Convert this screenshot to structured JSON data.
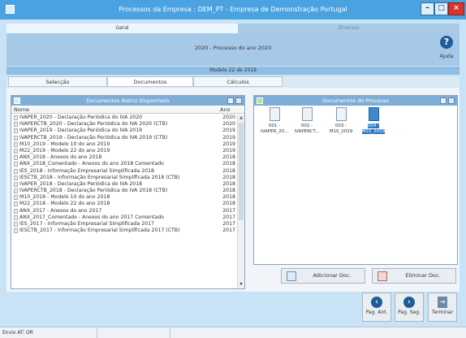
{
  "window": {
    "title": "Processos da Empresa : DEM_PT - Empresa de Demonstração Portugal"
  },
  "main_tabs": [
    "Geral",
    "Diversos"
  ],
  "process_title": "2020 - Processo do ano 2020",
  "help_label": "Ajuda",
  "modelo_title": "Modelo 22 de 2019",
  "sub_tabs": [
    "Selecção",
    "Documentos",
    "Cálculos"
  ],
  "left_panel": {
    "title": "Documentos Matriz Disponíveis",
    "col_nome": "Nome",
    "col_ano": "Ano",
    "rows": [
      {
        "name": "IVAPER_2020 - Declaração Periódica do IVA 2020",
        "year": "2020"
      },
      {
        "name": "IVAPERCTB_2020 - Declaração Periódica do IVA 2020  (CTB)",
        "year": "2020"
      },
      {
        "name": "IVAPER_2019 - Declaração Periódica do IVA 2019",
        "year": "2019"
      },
      {
        "name": "IVAPERCTB_2019 - Declaração Periódica do IVA 2019  (CTB)",
        "year": "2019"
      },
      {
        "name": "M10_2019 - Modelo 10 do ano 2019",
        "year": "2019"
      },
      {
        "name": "M22_2019 - Modelo 22 do ano 2019",
        "year": "2019"
      },
      {
        "name": "ANX_2018 - Anexos do ano 2018",
        "year": "2018"
      },
      {
        "name": "ANX_2018_Comentado - Anexos do ano 2018 Comentado",
        "year": "2018"
      },
      {
        "name": "IES_2018 - Informação Empresarial Simplificada 2018",
        "year": "2018"
      },
      {
        "name": "IESCTB_2018 - Informação Empresarial Simplificada 2018 (CTB)",
        "year": "2018"
      },
      {
        "name": "IVAPER_2018 - Declaração Periódica do IVA 2018",
        "year": "2018"
      },
      {
        "name": "IVAPERCTB_2018 - Declaração Periódica do IVA 2018  (CTB)",
        "year": "2018"
      },
      {
        "name": "M10_2018 - Modelo 10 do ano 2018",
        "year": "2018"
      },
      {
        "name": "M22_2018 - Modelo 22 do ano 2018",
        "year": "2018"
      },
      {
        "name": "ANX_2017 - Anexos do ano 2017",
        "year": "2017"
      },
      {
        "name": "ANX_2017_Comentado - Anexos do ano 2017 Comentado",
        "year": "2017"
      },
      {
        "name": "IES_2017 - Informação Empresarial Simplificada 2017",
        "year": "2017"
      },
      {
        "name": "IESCTB_2017 - Informação Empresarial Simplificada 2017 (CTB)",
        "year": "2017"
      }
    ]
  },
  "right_panel": {
    "title": "Documentos do Processo",
    "docs": [
      {
        "line1": "001 -",
        "line2": "IVAPER_20..."
      },
      {
        "line1": "002 -",
        "line2": "IVAPERCT..."
      },
      {
        "line1": "003 -",
        "line2": "M10_2019"
      },
      {
        "line1": "004 -",
        "line2": "M22_2019"
      }
    ]
  },
  "buttons": {
    "add": "Adicionar Doc.",
    "remove": "Eliminar Doc.",
    "prev": "Pag. Ant.",
    "next": "Pag. Seg.",
    "exit": "Terminar"
  },
  "status": {
    "text": "Envio AT: OR"
  },
  "colors": {
    "titlebar": "#4aa3e0",
    "accent": "#1e5d96",
    "panel_header": "#7eaed8",
    "selection": "#2b78c4"
  }
}
